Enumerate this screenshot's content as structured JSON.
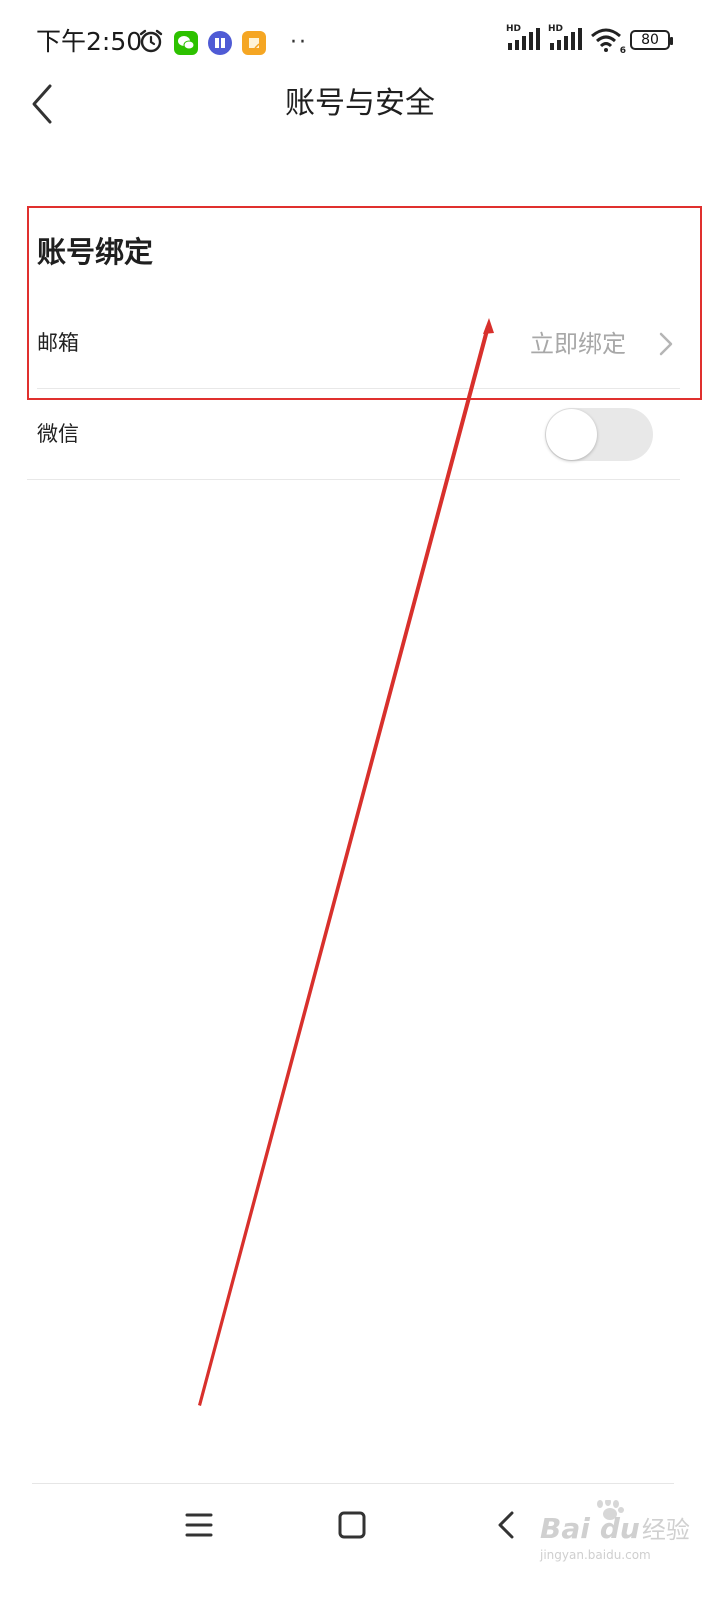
{
  "status_bar": {
    "time": "下午2:50",
    "icons": [
      "alarm-icon",
      "wechat-app-icon",
      "tieba-app-icon",
      "notes-app-icon",
      "more-dots-icon"
    ],
    "more": "··",
    "signal_label_1": "HD",
    "signal_label_2": "HD",
    "wifi_badge": "6",
    "battery": "80"
  },
  "header": {
    "back_icon": "chevron-left-icon",
    "title": "账号与安全"
  },
  "section": {
    "title": "账号绑定",
    "items": [
      {
        "label": "邮箱",
        "action": "立即绑定",
        "icon": "chevron-right-icon"
      },
      {
        "label": "微信",
        "toggle_on": false
      }
    ]
  },
  "nav_bar": {
    "icons": [
      "menu-icon",
      "home-square-icon",
      "back-chevron-icon"
    ]
  },
  "watermark": {
    "brand": "Bai",
    "brand2": "du",
    "suffix": "经验",
    "url": "jingyan.baidu.com"
  },
  "colors": {
    "highlight": "#e0302e",
    "secondary_text": "#a8a8a8",
    "toggle_off": "#e8e8e8",
    "wechat": "#2dc100",
    "tieba": "#4f5bd5",
    "notes": "#f5a623"
  }
}
